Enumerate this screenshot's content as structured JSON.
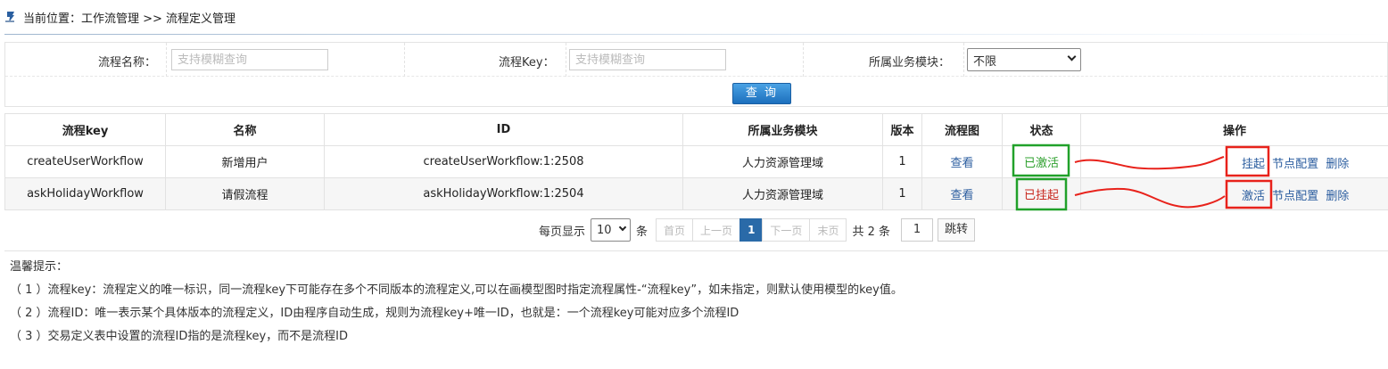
{
  "breadcrumb": {
    "text": "当前位置：工作流管理 >> 流程定义管理"
  },
  "search": {
    "name_label": "流程名称：",
    "name_placeholder": "支持模糊查询",
    "key_label": "流程Key：",
    "key_placeholder": "支持模糊查询",
    "module_label": "所属业务模块：",
    "module_value": "不限",
    "button": "查 询"
  },
  "table": {
    "headers": [
      "流程key",
      "名称",
      "ID",
      "所属业务模块",
      "版本",
      "流程图",
      "状态",
      "操作"
    ],
    "rows": [
      {
        "key": "createUserWorkflow",
        "name": "新增用户",
        "id": "createUserWorkflow:1:2508",
        "module": "人力资源管理域",
        "version": "1",
        "diagram": "查看",
        "status": "已激活",
        "op_toggle": "挂起",
        "op_config": "节点配置",
        "op_delete": "删除"
      },
      {
        "key": "askHolidayWorkflow",
        "name": "请假流程",
        "id": "askHolidayWorkflow:1:2504",
        "module": "人力资源管理域",
        "version": "1",
        "diagram": "查看",
        "status": "已挂起",
        "op_toggle": "激活",
        "op_config": "节点配置",
        "op_delete": "删除"
      }
    ]
  },
  "pager": {
    "per_page_label": "每页显示",
    "per_page_value": "10",
    "unit": "条",
    "first": "首页",
    "prev": "上一页",
    "current": "1",
    "next": "下一页",
    "last": "末页",
    "total": "共 2 条",
    "goto_value": "1",
    "goto_button": "跳转"
  },
  "tips": {
    "title": "温馨提示：",
    "lines": [
      "（ 1 ）流程key：流程定义的唯一标识，同一流程key下可能存在多个不同版本的流程定义,可以在画模型图时指定流程属性-“流程key”，如未指定，则默认使用模型的key值。",
      "（ 2 ）流程ID：唯一表示某个具体版本的流程定义，ID由程序自动生成，规则为流程key+唯一ID，也就是：一个流程key可能对应多个流程ID",
      "（ 3 ）交易定义表中设置的流程ID指的是流程key，而不是流程ID"
    ]
  },
  "colors": {
    "active": "#2ea02e",
    "suspended": "#c8261c",
    "link": "#2b5d9f",
    "primary": "#1c6fbd",
    "annotation_red": "#e8221b",
    "annotation_green": "#21a12a"
  }
}
